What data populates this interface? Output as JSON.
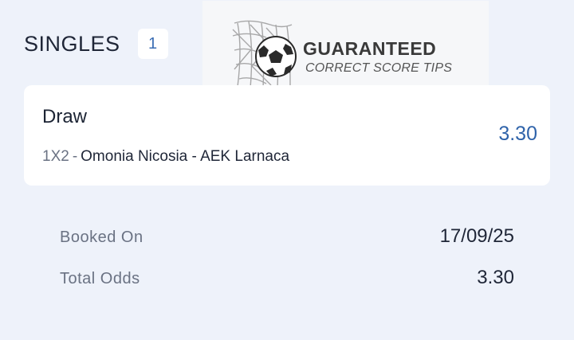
{
  "header": {
    "title": "SINGLES",
    "count": "1"
  },
  "watermark": {
    "title": "GUARANTEED",
    "subtitle": "CORRECT SCORE TIPS",
    "icon": "soccer-ball-in-net"
  },
  "bet": {
    "selection": "Draw",
    "market": "1X2",
    "separator": "-",
    "match": "Omonia Nicosia - AEK Larnaca",
    "odds": "3.30"
  },
  "summary": {
    "booked_label": "Booked On",
    "booked_value": "17/09/25",
    "total_label": "Total Odds",
    "total_value": "3.30"
  },
  "colors": {
    "background": "#eef2fa",
    "card": "#ffffff",
    "accent": "#2f63aa"
  }
}
